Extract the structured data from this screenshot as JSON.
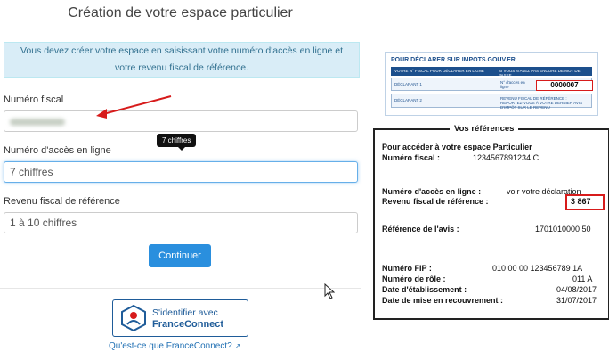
{
  "form": {
    "title": "Création de votre espace particulier",
    "info_text_line1": "Vous devez créer votre espace en saisissant votre numéro d'accès en ligne et",
    "info_text_line2": "votre revenu fiscal de référence.",
    "numero_fiscal": {
      "label": "Numéro fiscal"
    },
    "numero_acces": {
      "label": "Numéro d'accès en ligne",
      "value": "7 chiffres",
      "tooltip": "7 chiffres"
    },
    "revenu_fiscal": {
      "label": "Revenu fiscal de référence",
      "placeholder": "1 à 10 chiffres"
    },
    "submit_label": "Continuer",
    "franceconnect": {
      "line1": "S'identifier avec",
      "line2": "FranceConnect",
      "link": "Qu'est-ce que FranceConnect?"
    }
  },
  "doc_top": {
    "header": "POUR DÉCLARER SUR IMPOTS.GOUV.FR",
    "col1": "VOTRE N° FISCAL POUR DÉCLARER EN LIGNE",
    "col2": "SI VOUS N'AVEZ PAS ENCORE DE MOT DE PASSE",
    "row1_label": "DÉCLARANT 1",
    "row1_access_label": "N° d'accès en ligne",
    "row1_access_value": "0000007",
    "row2_label": "DÉCLARANT 2",
    "row2_text": "REVENU FISCAL DE RÉFÉRENCE : REPORTEZ-VOUS À VOTRE DERNIER AVIS D'IMPÔT SUR LE REVENU"
  },
  "refs": {
    "legend": "Vos références",
    "intro_line1": "Pour accéder à votre espace Particulier",
    "numero_fiscal_label": "Numéro fiscal :",
    "numero_fiscal_value": "1234567891234 C",
    "numero_acces_label": "Numéro d'accès en ligne :",
    "numero_acces_value": "voir votre déclaration",
    "revenu_label": "Revenu fiscal de référence :",
    "revenu_value": "3 867",
    "avis_label": "Référence de l'avis :",
    "avis_value": "1701010000 50",
    "fip_label": "Numéro FIP :",
    "fip_value": "010 00 00 123456789 1A",
    "role_label": "Numéro de rôle :",
    "role_value": "011 A",
    "etab_label": "Date d'établissement :",
    "etab_value": "04/08/2017",
    "recouv_label": "Date de mise en recouvrement :",
    "recouv_value": "31/07/2017"
  },
  "colors": {
    "primary": "#2a8fde",
    "info_bg": "#d9edf7",
    "highlight_red": "#d71b1b",
    "fc_blue": "#1f5c99"
  }
}
